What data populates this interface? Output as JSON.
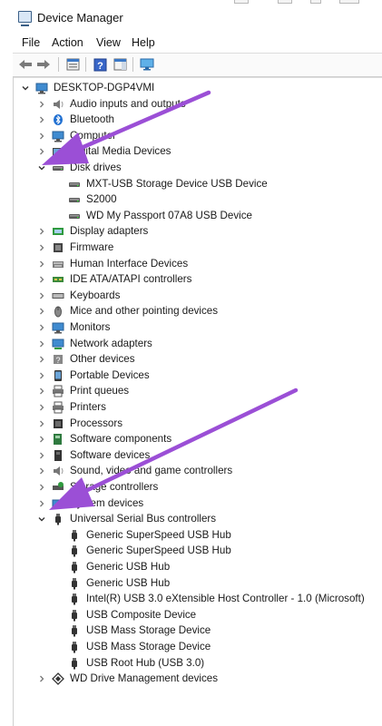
{
  "window": {
    "title": "Device Manager",
    "icon": "device-manager-icon"
  },
  "menu": [
    "File",
    "Action",
    "View",
    "Help"
  ],
  "toolbar": {
    "buttons": [
      "back-arrow-icon",
      "forward-arrow-icon",
      "properties-icon",
      "help-icon",
      "action-pane-icon",
      "monitor-icon"
    ]
  },
  "tree": {
    "root": {
      "label": "DESKTOP-DGP4VMI",
      "icon": "computer-icon",
      "expanded": true
    },
    "items": [
      {
        "label": "Audio inputs and outputs",
        "icon": "speaker-icon",
        "expanded": false
      },
      {
        "label": "Bluetooth",
        "icon": "bluetooth-icon",
        "expanded": false
      },
      {
        "label": "Computer",
        "icon": "computer-icon",
        "expanded": false
      },
      {
        "label": "Digital Media Devices",
        "icon": "media-device-icon",
        "expanded": false
      },
      {
        "label": "Disk drives",
        "icon": "disk-drive-icon",
        "expanded": true,
        "children": [
          {
            "label": "MXT-USB Storage Device USB Device",
            "icon": "disk-drive-icon"
          },
          {
            "label": "S2000",
            "icon": "disk-drive-icon"
          },
          {
            "label": "WD My Passport 07A8 USB Device",
            "icon": "disk-drive-icon"
          }
        ]
      },
      {
        "label": "Display adapters",
        "icon": "display-adapter-icon",
        "expanded": false
      },
      {
        "label": "Firmware",
        "icon": "firmware-icon",
        "expanded": false
      },
      {
        "label": "Human Interface Devices",
        "icon": "hid-icon",
        "expanded": false
      },
      {
        "label": "IDE ATA/ATAPI controllers",
        "icon": "ide-controller-icon",
        "expanded": false
      },
      {
        "label": "Keyboards",
        "icon": "keyboard-icon",
        "expanded": false
      },
      {
        "label": "Mice and other pointing devices",
        "icon": "mouse-icon",
        "expanded": false
      },
      {
        "label": "Monitors",
        "icon": "monitor-icon",
        "expanded": false
      },
      {
        "label": "Network adapters",
        "icon": "network-adapter-icon",
        "expanded": false
      },
      {
        "label": "Other devices",
        "icon": "unknown-device-icon",
        "expanded": false
      },
      {
        "label": "Portable Devices",
        "icon": "portable-device-icon",
        "expanded": false
      },
      {
        "label": "Print queues",
        "icon": "printer-icon",
        "expanded": false
      },
      {
        "label": "Printers",
        "icon": "printer-icon",
        "expanded": false
      },
      {
        "label": "Processors",
        "icon": "processor-icon",
        "expanded": false
      },
      {
        "label": "Software components",
        "icon": "software-component-icon",
        "expanded": false
      },
      {
        "label": "Software devices",
        "icon": "software-device-icon",
        "expanded": false
      },
      {
        "label": "Sound, video and game controllers",
        "icon": "speaker-icon",
        "expanded": false
      },
      {
        "label": "Storage controllers",
        "icon": "storage-controller-icon",
        "expanded": false
      },
      {
        "label": "System devices",
        "icon": "system-device-icon",
        "expanded": false
      },
      {
        "label": "Universal Serial Bus controllers",
        "icon": "usb-icon",
        "expanded": true,
        "children": [
          {
            "label": "Generic SuperSpeed USB Hub",
            "icon": "usb-icon"
          },
          {
            "label": "Generic SuperSpeed USB Hub",
            "icon": "usb-icon"
          },
          {
            "label": "Generic USB Hub",
            "icon": "usb-icon"
          },
          {
            "label": "Generic USB Hub",
            "icon": "usb-icon"
          },
          {
            "label": "Intel(R) USB 3.0 eXtensible Host Controller - 1.0 (Microsoft)",
            "icon": "usb-icon"
          },
          {
            "label": "USB Composite Device",
            "icon": "usb-icon"
          },
          {
            "label": "USB Mass Storage Device",
            "icon": "usb-icon"
          },
          {
            "label": "USB Mass Storage Device",
            "icon": "usb-icon"
          },
          {
            "label": "USB Root Hub (USB 3.0)",
            "icon": "usb-icon"
          }
        ]
      },
      {
        "label": "WD Drive Management devices",
        "icon": "wd-drive-icon",
        "expanded": false
      }
    ]
  },
  "annotations": {
    "arrow_color": "#9b4fd6",
    "arrows": [
      "arrow-to-disk-drives",
      "arrow-to-system-devices"
    ]
  }
}
